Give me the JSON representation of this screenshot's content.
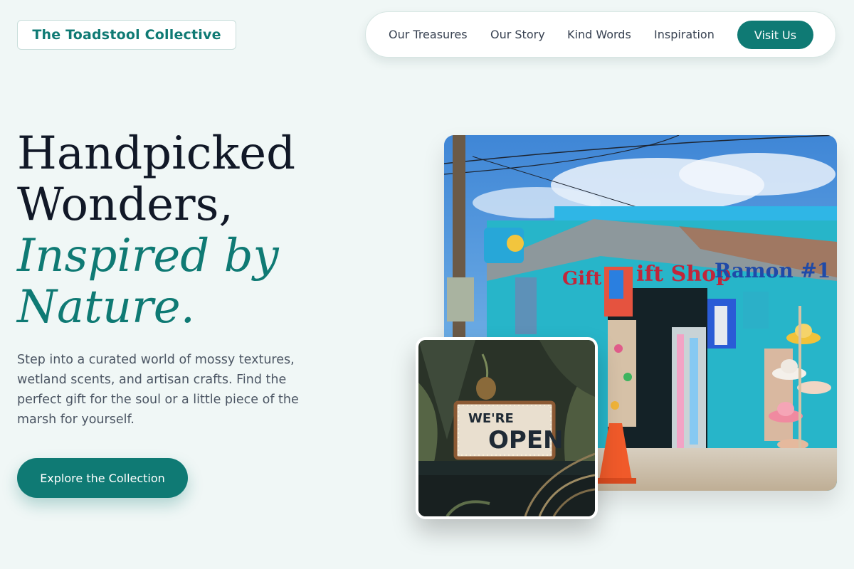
{
  "brand": {
    "name": "The Toadstool Collective"
  },
  "nav": {
    "items": [
      "Our Treasures",
      "Our Story",
      "Kind Words",
      "Inspiration"
    ],
    "cta": "Visit Us"
  },
  "hero": {
    "title_line1": "Handpicked",
    "title_line2": "Wonders,",
    "title_accent_line1": "Inspired by",
    "title_accent_line2": "Nature.",
    "description": "Step into a curated world of mossy textures, wetland scents, and artisan crafts. Find the perfect gift for the soul or a little piece of the marsh for yourself.",
    "cta": "Explore the Collection"
  },
  "images": {
    "shop_sign_left": "Gift",
    "shop_sign_mid": "ift Shop",
    "shop_sign_right": "Ramon #1",
    "open_sign_top": "WE'RE",
    "open_sign_bottom": "OPEN"
  },
  "colors": {
    "accent": "#0f7a74",
    "background": "#f0f7f6"
  }
}
